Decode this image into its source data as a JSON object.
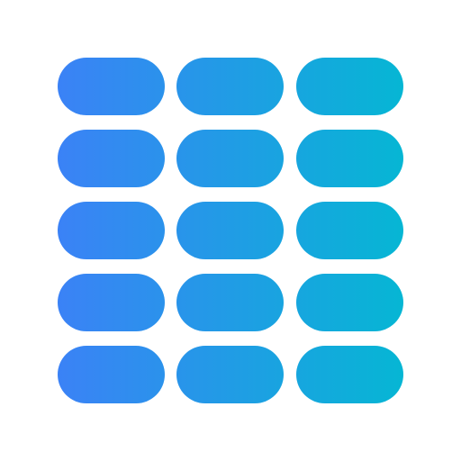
{
  "icon": {
    "name": "grid-of-pills-icon",
    "rows": 5,
    "columns": 3,
    "colors": {
      "gradient_start": "#3B82F6",
      "gradient_end": "#06B6D4",
      "background": "#FFFFFF"
    }
  }
}
